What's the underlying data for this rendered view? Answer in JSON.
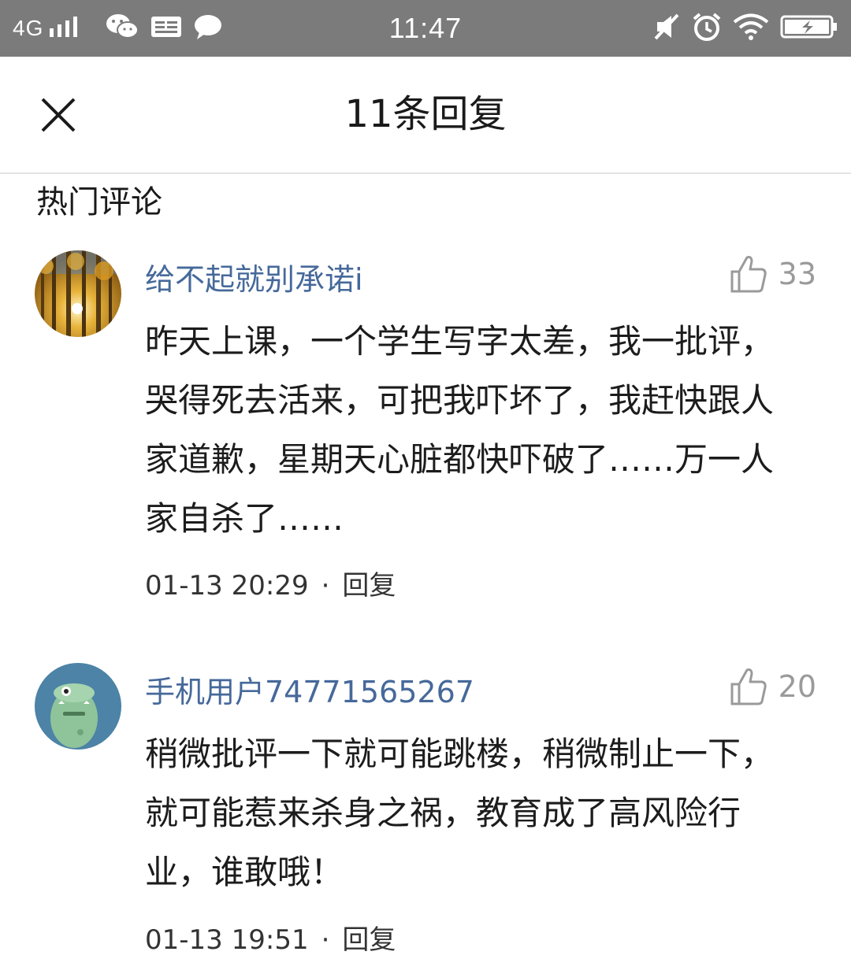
{
  "status_bar": {
    "network": "4G",
    "signal_icon": "signal-bars-icon",
    "app_icons": [
      "wechat-icon",
      "toutiao-icon",
      "message-bubble-icon"
    ],
    "time": "11:47",
    "right_icons": [
      "vibrate-off-icon",
      "alarm-icon",
      "wifi-icon",
      "battery-charging-icon"
    ]
  },
  "header": {
    "title": "11条回复",
    "close_icon": "close-icon"
  },
  "section": {
    "title": "热门评论"
  },
  "comments": [
    {
      "username": "给不起就别承诺i",
      "likes": "33",
      "text": "昨天上课，一个学生写字太差，我一批评，哭得死去活来，可把我吓坏了，我赶快跟人家道歉，星期天心脏都快吓破了……万一人家自杀了……",
      "time": "01-13 20:29",
      "separator": "·",
      "reply": "回复",
      "avatar": "forest-avatar"
    },
    {
      "username": "手机用户74771565267",
      "likes": "20",
      "text": "稍微批评一下就可能跳楼，稍微制止一下，就可能惹来杀身之祸，教育成了高风险行业，谁敢哦！",
      "time": "01-13 19:51",
      "separator": "·",
      "reply": "回复",
      "avatar": "green-monster-avatar"
    }
  ]
}
